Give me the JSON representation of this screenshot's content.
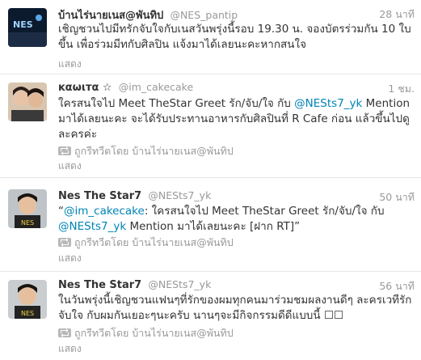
{
  "tweets": [
    {
      "fullname": "บ้านไร่นายเนส@พันทิป",
      "username": "@NES_pantip",
      "time": "28 นาที",
      "text": "เชิญชวนไปมีทรักจับใจกับเนสวันพรุ่งนี้รอบ 19.30 น. จองบัตรร่วมกัน 10 ใบ ขึ้น เพื่อร่วมมีทกับศิลปิน แจ้งมาได้เลยนะคะหากสนใจ",
      "retweeted_by": "",
      "expand": "แสดง"
    },
    {
      "fullname": "ĸαωιтα ☆",
      "username": "@im_cakecake",
      "time": "1 ชม.",
      "text_parts": [
        "ใครสนใจไป Meet TheStar Greet รัก/จับ/ใจ กับ ",
        "@NESts7_yk",
        " Mention มาได้เลยนะคะ จะได้รับประทานอาหารกับศิลปินที่ R Cafe ก่อน แล้วขึ้นไปดูละครค่ะ"
      ],
      "retweeted_by": "ถูกรีทวีตโดย บ้านไร่นายเนส@พันทิป",
      "expand": "แสดง"
    },
    {
      "fullname": "Nes The Star7",
      "username": "@NESts7_yk",
      "time": "50 นาที",
      "text_parts": [
        "“",
        "@im_cakecake",
        ": ใครสนใจไป Meet TheStar Greet รัก/จับ/ใจ กับ ",
        "@NESts7_yk",
        " Mention มาได้เลยนะคะ [ฝาก RT]”"
      ],
      "retweeted_by": "ถูกรีทวีตโดย บ้านไร่นายเนส@พันทิป",
      "expand": "แสดง"
    },
    {
      "fullname": "Nes The Star7",
      "username": "@NESts7_yk",
      "time": "56 นาที",
      "text": "ในวันพรุ่งนี้เชิญชวนแฟนๆที่รักของผมทุกคนมาร่วมชมผลงานดีๆ ละครเวทีรักจับใจ กับผมกันเยอะๆนะครับ นานๆจะมีกิจกรรมดีดีแบบนี้ ☐☐",
      "retweeted_by": "ถูกรีทวีตโดย บ้านไร่นายเนส@พันทิป",
      "expand": "แสดง"
    }
  ],
  "colors": {
    "link": "#0084b4",
    "meta": "#999999",
    "text": "#333333",
    "divider": "#e6e6e6"
  }
}
